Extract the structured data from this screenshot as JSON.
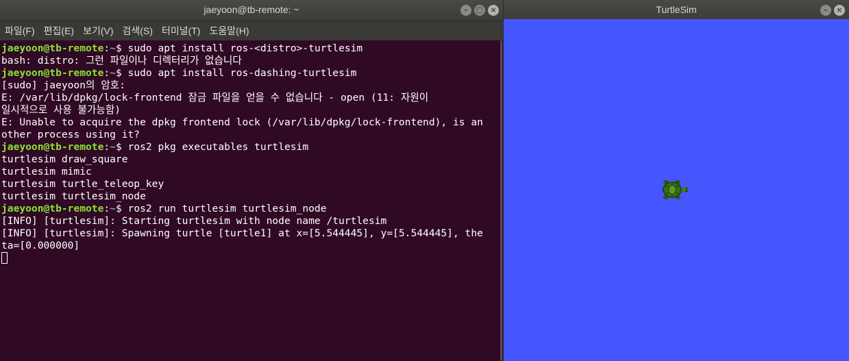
{
  "terminal": {
    "title": "jaeyoon@tb-remote: ~",
    "menu": [
      "파일(F)",
      "편집(E)",
      "보기(V)",
      "검색(S)",
      "터미널(T)",
      "도움말(H)"
    ],
    "prompt_user": "jaeyoon@tb-remote",
    "prompt_path": "~",
    "lines": [
      {
        "type": "cmd",
        "text": "sudo apt install ros-<distro>-turtlesim"
      },
      {
        "type": "out",
        "text": "bash: distro: 그런 파일이나 디렉터리가 없습니다"
      },
      {
        "type": "cmd",
        "text": "sudo apt install ros-dashing-turtlesim"
      },
      {
        "type": "out",
        "text": "[sudo] jaeyoon의 암호:"
      },
      {
        "type": "out",
        "text": "E: /var/lib/dpkg/lock-frontend 잠금 파일을 얻을 수 없습니다 - open (11: 자원이"
      },
      {
        "type": "out",
        "text": "일시적으로 사용 불가능함)"
      },
      {
        "type": "out",
        "text": "E: Unable to acquire the dpkg frontend lock (/var/lib/dpkg/lock-frontend), is an"
      },
      {
        "type": "out",
        "text": "other process using it?"
      },
      {
        "type": "cmd",
        "text": "ros2 pkg executables turtlesim"
      },
      {
        "type": "out",
        "text": "turtlesim draw_square"
      },
      {
        "type": "out",
        "text": "turtlesim mimic"
      },
      {
        "type": "out",
        "text": "turtlesim turtle_teleop_key"
      },
      {
        "type": "out",
        "text": "turtlesim turtlesim_node"
      },
      {
        "type": "cmd",
        "text": "ros2 run turtlesim turtlesim_node"
      },
      {
        "type": "out",
        "text": "[INFO] [turtlesim]: Starting turtlesim with node name /turtlesim"
      },
      {
        "type": "out",
        "text": "[INFO] [turtlesim]: Spawning turtle [turtle1] at x=[5.544445], y=[5.544445], the"
      },
      {
        "type": "out",
        "text": "ta=[0.000000]"
      },
      {
        "type": "cursor",
        "text": ""
      }
    ]
  },
  "turtlesim": {
    "title": "TurtleSim",
    "background_color": "#4556ff",
    "turtle_name": "turtle1"
  },
  "window_buttons": {
    "minimize": "–",
    "maximize": "□",
    "close": "×"
  },
  "colors": {
    "terminal_bg": "#300a24",
    "prompt_user": "#8ae234",
    "prompt_path": "#729fcf"
  }
}
